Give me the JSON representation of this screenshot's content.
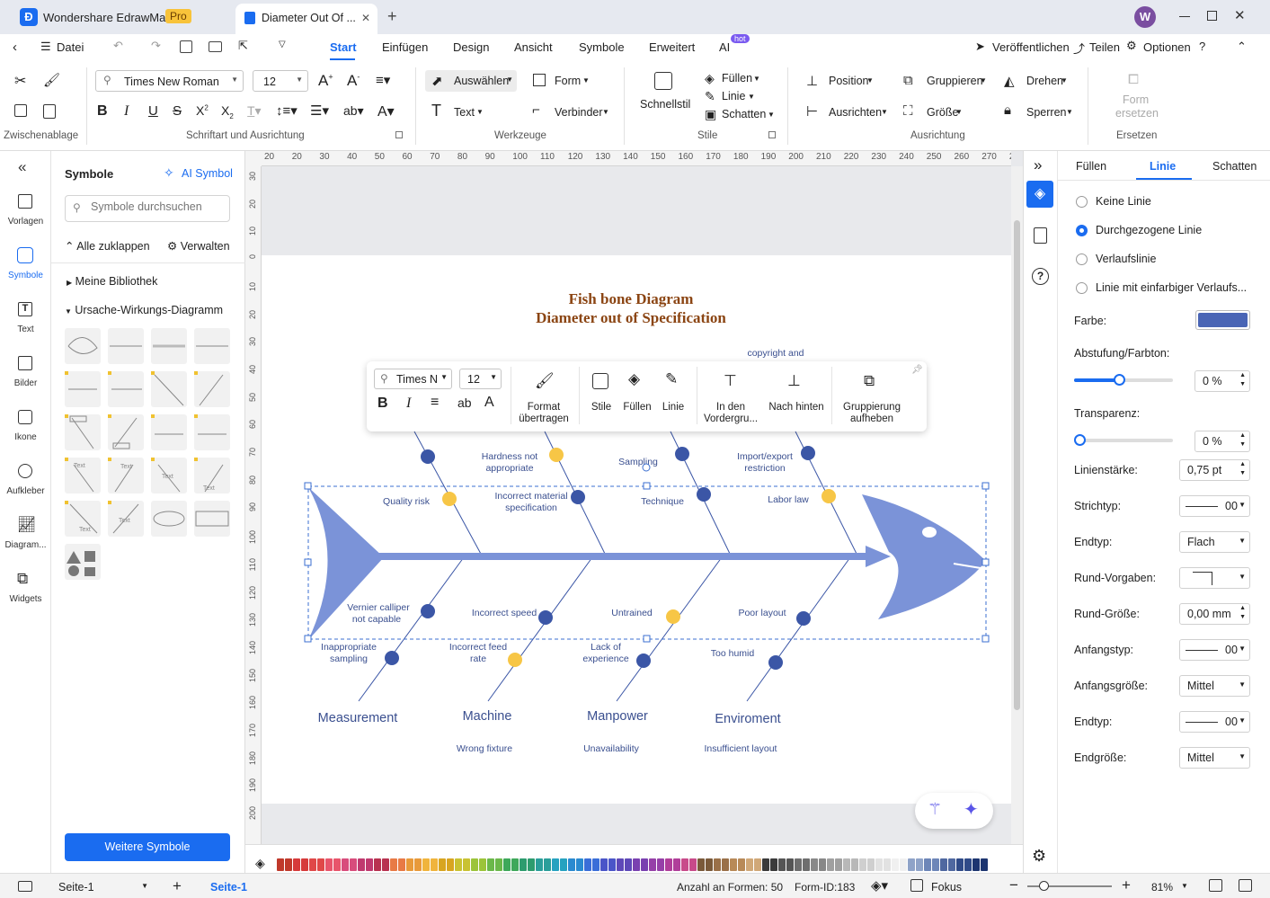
{
  "titlebar": {
    "app_name": "Wondershare EdrawMax",
    "pro_badge": "Pro",
    "doc_tab": "Diameter Out Of ...",
    "close_x": "✕",
    "new_tab": "+",
    "avatar": "W"
  },
  "menu": {
    "file": "Datei",
    "tabs": [
      "Start",
      "Einfügen",
      "Design",
      "Ansicht",
      "Symbole",
      "Erweitert",
      "AI"
    ],
    "hot": "hot",
    "publish": "Veröffentlichen",
    "share": "Teilen",
    "options": "Optionen"
  },
  "ribbon": {
    "font": "Times New Roman",
    "size": "12",
    "select": "Auswählen",
    "form": "Form",
    "text": "Text",
    "connector": "Verbinder",
    "quickstyle": "Schnellstil",
    "fill": "Füllen",
    "line": "Linie",
    "shadow": "Schatten",
    "position": "Position",
    "group": "Gruppieren",
    "rotate": "Drehen",
    "align": "Ausrichten",
    "size_lbl": "Größe",
    "lock": "Sperren",
    "replace_form": "Form",
    "replace_form2": "ersetzen",
    "groups": {
      "clipboard": "Zwischenablage",
      "font_align": "Schriftart und Ausrichtung",
      "tools": "Werkzeuge",
      "styles": "Stile",
      "arrange": "Ausrichtung",
      "replace": "Ersetzen"
    }
  },
  "leftnav": [
    "Vorlagen",
    "Symbole",
    "Text",
    "Bilder",
    "Ikone",
    "Aufkleber",
    "Diagram...",
    "Widgets"
  ],
  "symbols": {
    "title": "Symbole",
    "ai": "AI Symbol",
    "search_placeholder": "Symbole durchsuchen",
    "collapse": "Alle zuklappen",
    "manage": "Verwalten",
    "library": "Meine Bibliothek",
    "category": "Ursache-Wirkungs-Diagramm",
    "thumb_text": "Text",
    "more": "Weitere Symbole"
  },
  "ruler_h": [
    "20",
    "20",
    "30",
    "40",
    "50",
    "60",
    "70",
    "80",
    "90",
    "100",
    "110",
    "120",
    "130",
    "140",
    "150",
    "160",
    "170",
    "180",
    "190",
    "200",
    "210",
    "220",
    "230",
    "240",
    "250",
    "260",
    "270",
    "280"
  ],
  "ruler_v": [
    "30",
    "20",
    "10",
    "0",
    "10",
    "20",
    "30",
    "40",
    "50",
    "60",
    "70",
    "80",
    "90",
    "100",
    "110",
    "120",
    "130",
    "140",
    "150",
    "160",
    "170",
    "180",
    "190",
    "200"
  ],
  "diagram": {
    "title1": "Fish bone Diagram",
    "title2": "Diameter out of Specification",
    "labels": {
      "copyright": "copyright and",
      "hardness": [
        "Hardness not",
        "appropriate"
      ],
      "sampling_top": "Sampling",
      "import": [
        "Import/export",
        "restriction"
      ],
      "quality": "Quality risk",
      "incorrect_mat": [
        "Incorrect material",
        "specification"
      ],
      "technique": "Technique",
      "labor": "Labor law",
      "vernier": [
        "Vernier calliper",
        "not capable"
      ],
      "incorrect_speed": "Incorrect speed",
      "untrained": "Untrained",
      "poor_layout": "Poor layout",
      "inappropriate": [
        "Inappropriate",
        "sampling"
      ],
      "incorrect_feed": [
        "Incorrect feed",
        "rate"
      ],
      "lack": [
        "Lack of",
        "experience"
      ],
      "too_humid": "Too humid",
      "measurement": "Measurement",
      "machine": "Machine",
      "manpower": "Manpower",
      "environment": "Enviroment",
      "wrong_fixture": "Wrong fixture",
      "unavailability": "Unavailability",
      "insufficient": "Insufficient layout"
    },
    "colors": {
      "fish": "#7b93d8",
      "dot_blue": "#3b56a6",
      "dot_yellow": "#f7c646",
      "title": "#8b4513",
      "label": "#3a4f8f"
    }
  },
  "floating_toolbar": {
    "font": "Times N",
    "size": "12",
    "format": [
      "Format",
      "übertragen"
    ],
    "styles": "Stile",
    "fill": "Füllen",
    "line": "Linie",
    "front": [
      "In den",
      "Vordergru..."
    ],
    "back": "Nach hinten",
    "ungroup": [
      "Gruppierung",
      "aufheben"
    ]
  },
  "props": {
    "tabs": [
      "Füllen",
      "Linie",
      "Schatten"
    ],
    "radios": [
      "Keine Linie",
      "Durchgezogene Linie",
      "Verlaufslinie",
      "Linie mit einfarbiger Verlaufs..."
    ],
    "color_lbl": "Farbe:",
    "color": "#4a65b5",
    "shade_lbl": "Abstufung/Farbton:",
    "shade_val": "0 %",
    "shade_pct": 0.45,
    "transp_lbl": "Transparenz:",
    "transp_val": "0 %",
    "width_lbl": "Linienstärke:",
    "width_val": "0,75 pt",
    "dash_lbl": "Strichtyp:",
    "dash_val": "00",
    "end_lbl": "Endtyp:",
    "end_val": "Flach",
    "round_lbl": "Rund-Vorgaben:",
    "roundsz_lbl": "Rund-Größe:",
    "roundsz_val": "0,00 mm",
    "start_lbl": "Anfangstyp:",
    "start_val": "00",
    "startsz_lbl": "Anfangsgröße:",
    "startsz_val": "Mittel",
    "end2_lbl": "Endtyp:",
    "end2_val": "00",
    "endsz_lbl": "Endgröße:",
    "endsz_val": "Mittel"
  },
  "status": {
    "page_sel": "Seite-1",
    "page_tab": "Seite-1",
    "count": "Anzahl an Formen: 50",
    "form_id": "Form-ID:183",
    "focus": "Fokus",
    "zoom": "81%"
  },
  "palette": [
    "#c0392b",
    "#d63a3a",
    "#e04848",
    "#e8556b",
    "#d84c7c",
    "#c0396f",
    "#b83250",
    "#e87a45",
    "#e89a3a",
    "#f0b43c",
    "#d8a520",
    "#c9c232",
    "#9cc43a",
    "#6bb84a",
    "#3ea85a",
    "#2d9c6e",
    "#2a9e9a",
    "#26a2c0",
    "#2a8ad0",
    "#3a6ed8",
    "#4a55c8",
    "#5e48b8",
    "#7a40b0",
    "#9640a8",
    "#b03e9a",
    "#c84a8a",
    "#7a5a3a",
    "#9a7048",
    "#b88a58",
    "#d0a878",
    "#3a3a3a",
    "#555555",
    "#6e6e6e",
    "#888888",
    "#a0a0a0",
    "#b8b8b8",
    "#cfcfcf",
    "#e2e2e2",
    "#f0f0f0",
    "#8fa3c8",
    "#6d86b8",
    "#4f68a0",
    "#2f4a88",
    "#1d3570"
  ]
}
